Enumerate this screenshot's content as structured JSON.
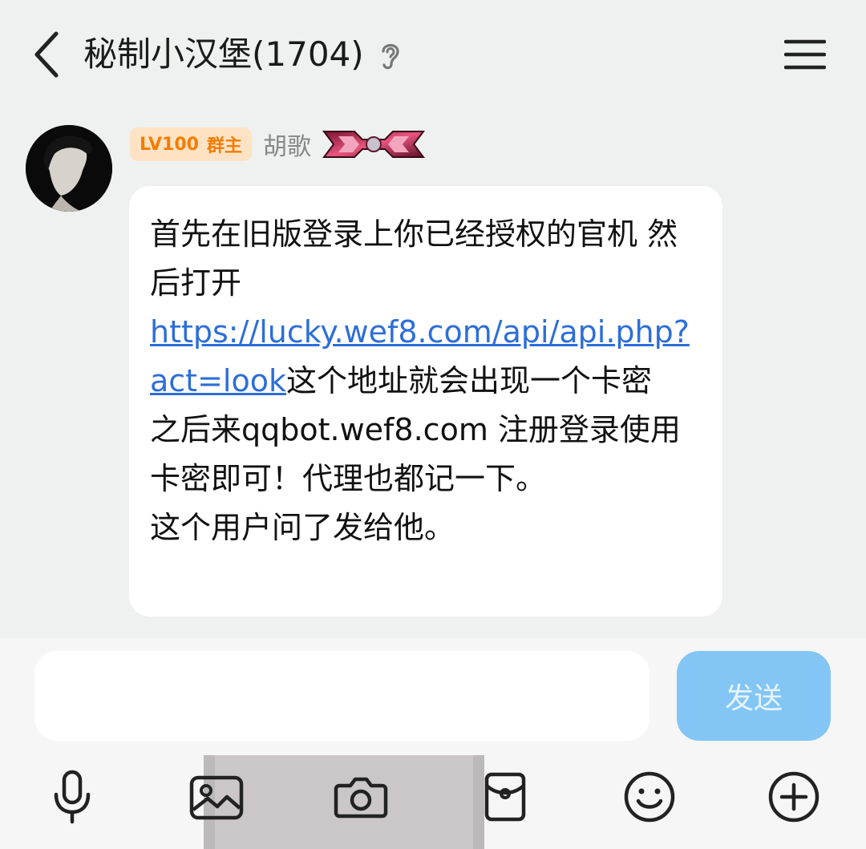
{
  "header": {
    "title": "秘制小汉堡(1704)",
    "back_icon": "chevron-left-icon",
    "ear_icon": "ear-icon",
    "menu_icon": "hamburger-menu-icon"
  },
  "message": {
    "level_label": "LV100",
    "role_label": "群主",
    "sender_name": "胡歌",
    "text_before_link": "首先在旧版登录上你已经授权的官机 然后打开",
    "link": "https://lucky.wef8.com/api/api.php?act=look",
    "text_after_link": "这个地址就会出现一个卡密",
    "line_2": "之后来qqbot.wef8.com 注册登录使用卡密即可！代理也都记一下。",
    "line_3": "这个用户问了发给他。"
  },
  "input": {
    "value": "",
    "send_label": "发送"
  },
  "toolbar": {
    "items": [
      "microphone-icon",
      "image-icon",
      "camera-icon",
      "red-packet-icon",
      "emoji-icon",
      "plus-circle-icon"
    ]
  },
  "colors": {
    "background": "#eef1ef",
    "bubble": "#ffffff",
    "link": "#2d6ed8",
    "level_badge_bg": "#fde3c4",
    "level_badge_text": "#f57c00",
    "send_button": "#83c6f5"
  }
}
